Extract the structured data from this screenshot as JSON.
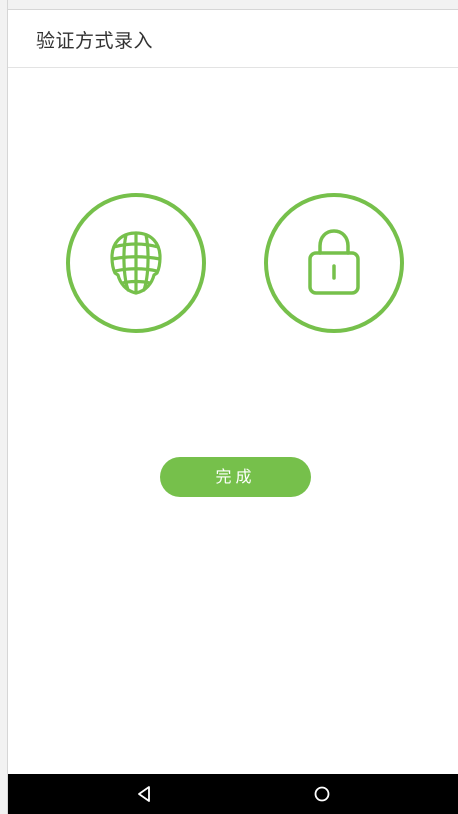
{
  "header": {
    "title": "验证方式录入"
  },
  "methods": [
    {
      "icon": "face-icon"
    },
    {
      "icon": "lock-icon"
    }
  ],
  "actions": {
    "done_label": "完成"
  },
  "colors": {
    "accent": "#76c04b",
    "navbar": "#000000",
    "background": "#ffffff"
  },
  "navbar": {
    "icons": [
      "back-icon",
      "home-icon"
    ]
  }
}
